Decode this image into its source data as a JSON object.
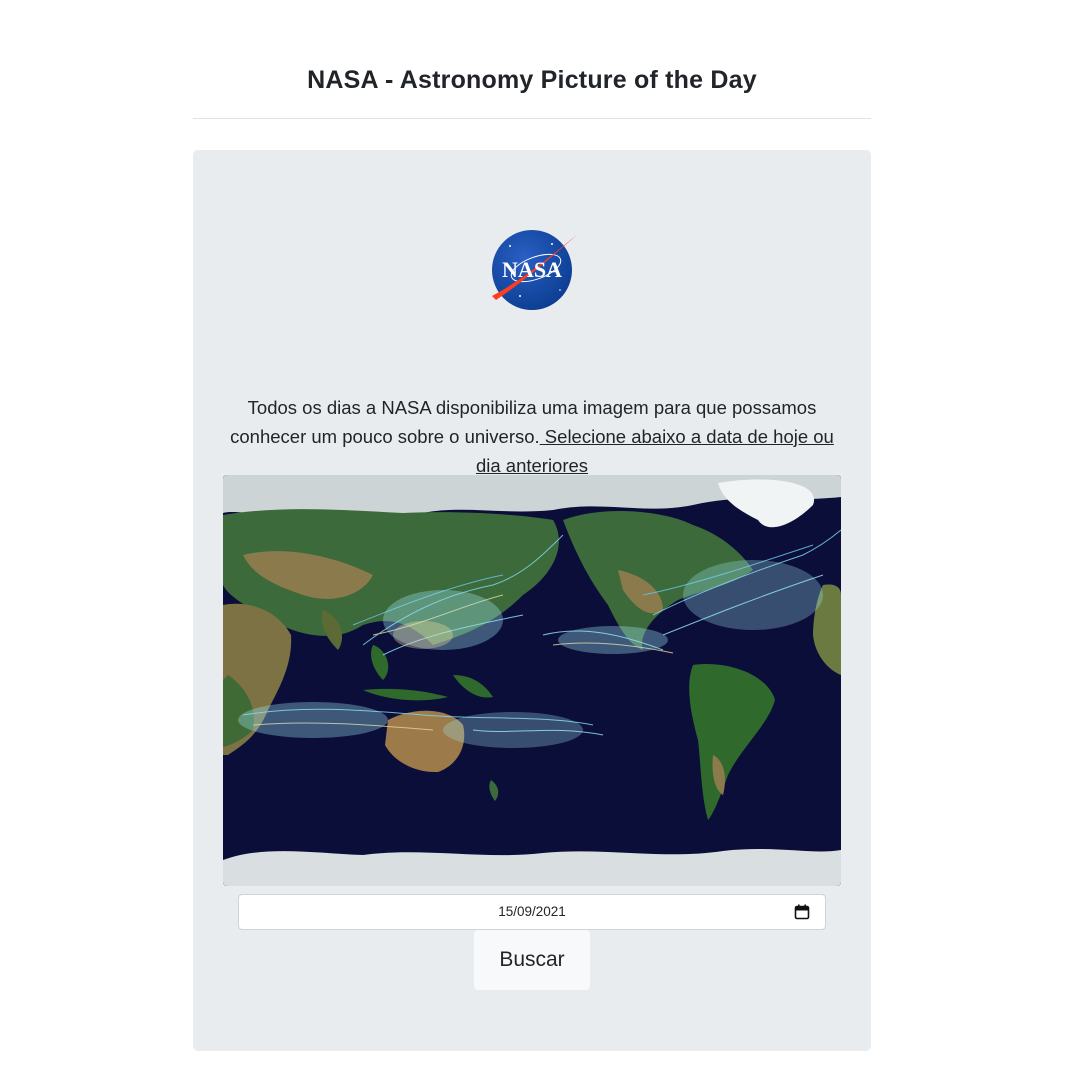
{
  "header": {
    "title": "NASA - Astronomy Picture of the Day"
  },
  "logo": {
    "text": "NASA"
  },
  "intro": {
    "text": "Todos os dias a NASA disponibiliza uma imagem para que possamos conhecer um pouco sobre o universo.",
    "link": " Selecione abaixo a data de hoje ou dia anteriores "
  },
  "date_picker": {
    "value": "15/09/2021",
    "icon": "calendar-icon"
  },
  "search_button": {
    "label": "Buscar"
  },
  "colors": {
    "card_bg": "#e9ecef",
    "logo_blue": "#0b3d91",
    "logo_red": "#fc3d21",
    "ocean": "#0c0e3a"
  }
}
